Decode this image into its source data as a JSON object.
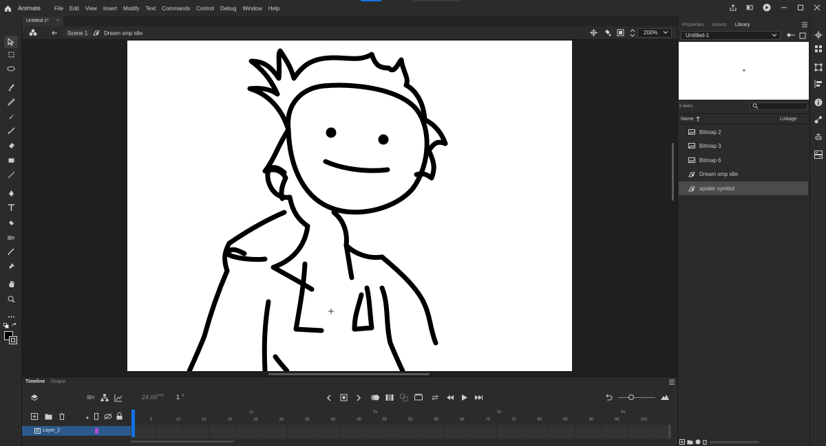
{
  "app": {
    "name": "Animate",
    "menus": [
      "File",
      "Edit",
      "View",
      "Insert",
      "Modify",
      "Text",
      "Commands",
      "Control",
      "Debug",
      "Window",
      "Help"
    ]
  },
  "document": {
    "tab_label": "Untitled-1*",
    "scene_label": "Scene 1",
    "symbol_label": "Dream smp idle",
    "zoom": "200%"
  },
  "right_panel": {
    "tabs": [
      "Properties",
      "Assets",
      "Library"
    ],
    "active_tab": "Library",
    "library_doc": "Untitled-1",
    "item_count": "5 items",
    "col_name": "Name",
    "col_linkage": "Linkage",
    "items": [
      {
        "label": "Bitmap 2",
        "icon": "bitmap-icon"
      },
      {
        "label": "Bitmap 3",
        "icon": "bitmap-icon"
      },
      {
        "label": "Bitmap 6",
        "icon": "bitmap-icon"
      },
      {
        "label": "Dream smp idle",
        "icon": "movieclip-icon"
      },
      {
        "label": "spoiler symbol",
        "icon": "movieclip-icon",
        "selected": true
      }
    ]
  },
  "timeline": {
    "tabs": [
      "Timeline",
      "Output"
    ],
    "active_tab": "Timeline",
    "fps": "24.00",
    "fps_unit": "FPS",
    "current_frame": "1",
    "frame_unit": "F",
    "layer_name": "Layer_2",
    "ruler_numbers": [
      "5",
      "10",
      "15",
      "20",
      "25",
      "30",
      "35",
      "40",
      "45",
      "50",
      "55",
      "60",
      "65",
      "70",
      "75",
      "80",
      "85",
      "90",
      "95",
      "100"
    ],
    "ruler_seconds": [
      "1s",
      "2s",
      "3s",
      "4s"
    ]
  },
  "colors": {
    "accent": "#1473e6",
    "stage": "#ffffff",
    "panel": "#2b2b2b",
    "layer_highlight": "#2d5a8c"
  }
}
